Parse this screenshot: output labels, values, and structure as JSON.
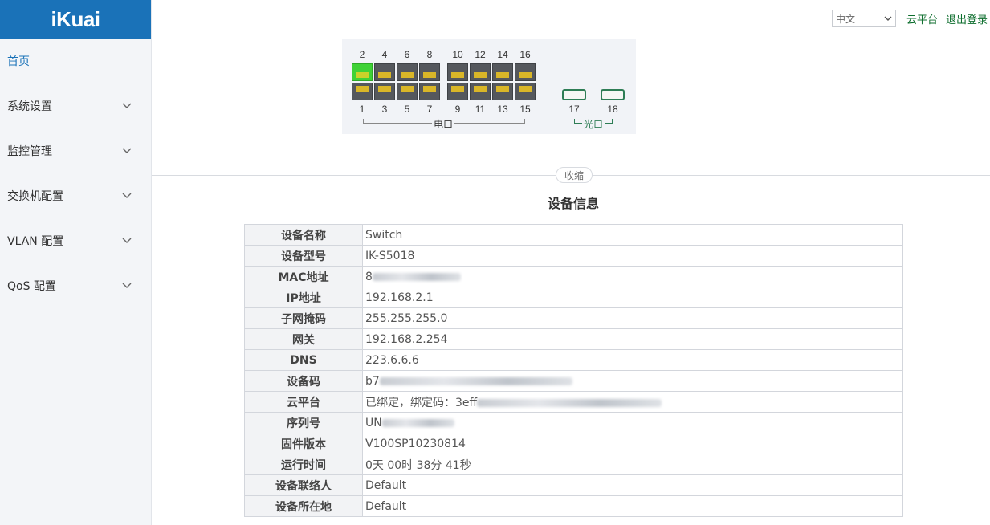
{
  "app": {
    "logo": "iKuai"
  },
  "sidebar": {
    "items": [
      {
        "label": "首页",
        "active": true,
        "expandable": false
      },
      {
        "label": "系统设置",
        "active": false,
        "expandable": true
      },
      {
        "label": "监控管理",
        "active": false,
        "expandable": true
      },
      {
        "label": "交换机配置",
        "active": false,
        "expandable": true
      },
      {
        "label": "VLAN 配置",
        "active": false,
        "expandable": true
      },
      {
        "label": "QoS 配置",
        "active": false,
        "expandable": true
      }
    ]
  },
  "header": {
    "language": "中文",
    "cloud_link": "云平台",
    "logout_link": "退出登录"
  },
  "switch_panel": {
    "top_ports": [
      "2",
      "4",
      "6",
      "8",
      "10",
      "12",
      "14",
      "16"
    ],
    "bottom_ports": [
      "1",
      "3",
      "5",
      "7",
      "9",
      "11",
      "13",
      "15"
    ],
    "sfp_ports": [
      "17",
      "18"
    ],
    "electric_label": "电口",
    "optical_label": "光口",
    "active_port": "2"
  },
  "collapse_label": "收缩",
  "section_title": "设备信息",
  "device_info": [
    {
      "key": "设备名称",
      "value": "Switch"
    },
    {
      "key": "设备型号",
      "value": "IK-S5018"
    },
    {
      "key": "MAC地址",
      "value": "8"
    },
    {
      "key": "IP地址",
      "value": "192.168.2.1"
    },
    {
      "key": "子网掩码",
      "value": "255.255.255.0"
    },
    {
      "key": "网关",
      "value": "192.168.2.254"
    },
    {
      "key": "DNS",
      "value": "223.6.6.6"
    },
    {
      "key": "设备码",
      "value": "b7"
    },
    {
      "key": "云平台",
      "value": "已绑定，绑定码：3eff"
    },
    {
      "key": "序列号",
      "value": "UN"
    },
    {
      "key": "固件版本",
      "value": "V100SP10230814"
    },
    {
      "key": "运行时间",
      "value": "0天 00时 38分 41秒"
    },
    {
      "key": "设备联络人",
      "value": "Default"
    },
    {
      "key": "设备所在地",
      "value": "Default"
    }
  ],
  "colors": {
    "brand": "#1a72b8",
    "link": "#0e6e2e",
    "active_port": "#3fd236"
  }
}
